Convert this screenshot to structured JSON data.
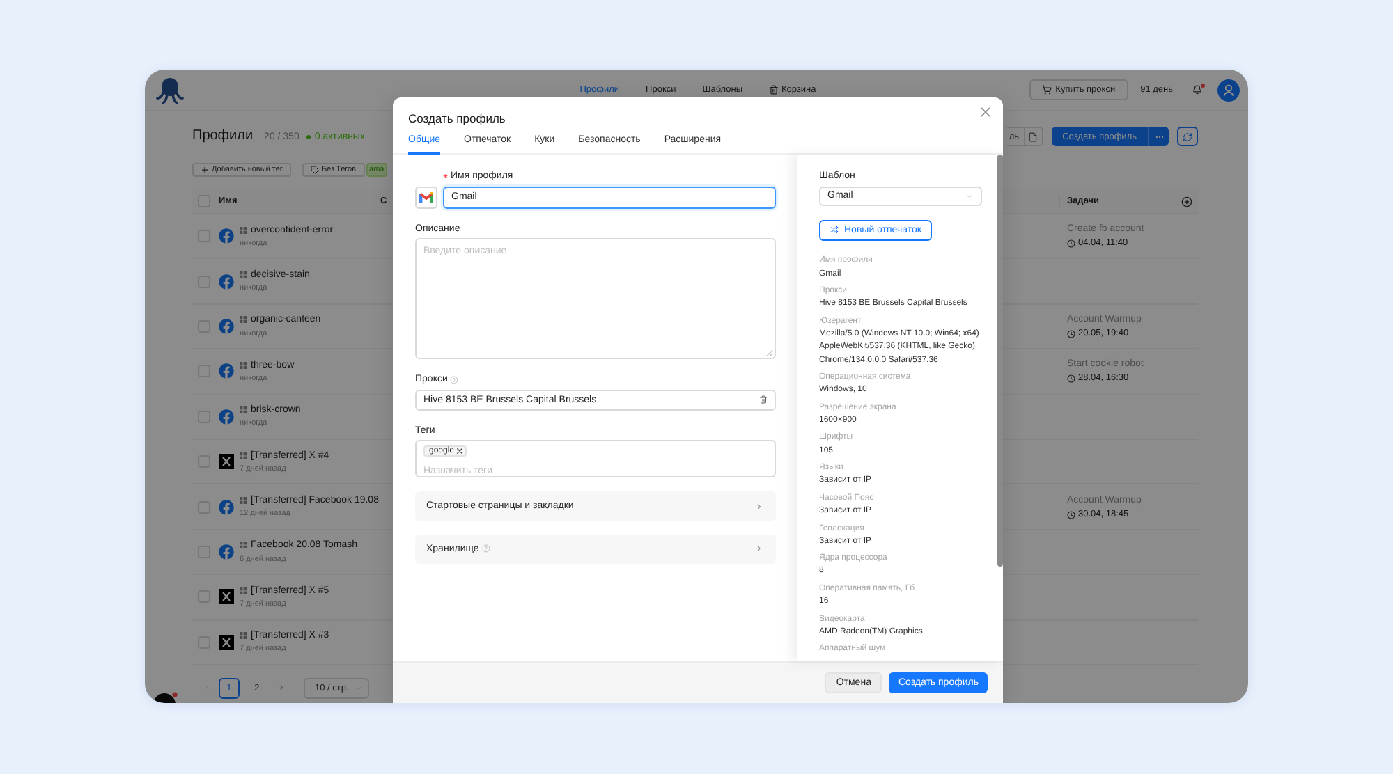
{
  "app_bar": {
    "nav": [
      {
        "label": "Профили",
        "kind": "page",
        "selected": true
      },
      {
        "label": "Прокси",
        "kind": "page",
        "selected": false
      },
      {
        "label": "Шаблоны",
        "kind": "page",
        "selected": false
      },
      {
        "label": "Корзина",
        "kind": "bin",
        "selected": false
      }
    ],
    "buy_button": "Купить прокси",
    "days_left": "91 день",
    "has_unread": true
  },
  "page": {
    "title": "Профили",
    "count": "20 / 350",
    "active": "0 активных",
    "partial_button": "ль",
    "create_button": "Создать профиль"
  },
  "tag_filters": [
    {
      "label": "Добавить новый тег",
      "kind": "add"
    },
    {
      "label": "Без Тегов",
      "kind": "untagged"
    },
    {
      "label": "ama",
      "kind": "tag"
    }
  ],
  "table": {
    "all_checked": false,
    "columns": [
      "Имя",
      "С",
      "Задачи"
    ],
    "rows": [
      {
        "kind": "facebook",
        "name": "overconfident-error",
        "last_used": "никогда",
        "checked": false,
        "task": {
          "title": "Create fb account",
          "time": "04.04, 11:40"
        }
      },
      {
        "kind": "facebook",
        "name": "decisive-stain",
        "last_used": "никогда",
        "checked": false
      },
      {
        "kind": "facebook",
        "name": "organic-canteen",
        "last_used": "никогда",
        "checked": false,
        "task": {
          "title": "Account Warmup",
          "time": "20.05, 19:40"
        }
      },
      {
        "kind": "facebook",
        "name": "three-bow",
        "last_used": "никогда",
        "checked": false,
        "task": {
          "title": "Start cookie robot",
          "time": "28.04, 16:30"
        }
      },
      {
        "kind": "facebook",
        "name": "brisk-crown",
        "last_used": "никогда",
        "checked": false
      },
      {
        "kind": "x",
        "name": "[Transferred] X #4",
        "last_used": "7 дней назад",
        "checked": false
      },
      {
        "kind": "facebook",
        "name": "[Transferred] Facebook 19.08",
        "last_used": "12 дней назад",
        "checked": false,
        "task": {
          "title": "Account Warmup",
          "time": "30.04, 18:45"
        }
      },
      {
        "kind": "facebook",
        "name": "Facebook 20.08 Tomash",
        "last_used": "6 дней назад",
        "checked": false
      },
      {
        "kind": "x",
        "name": "[Transferred] X #5",
        "last_used": "7 дней назад",
        "checked": false
      },
      {
        "kind": "x",
        "name": "[Transferred] X #3",
        "last_used": "7 дней назад",
        "checked": false
      }
    ]
  },
  "pagination": {
    "prev_disabled": true,
    "next_disabled": false,
    "pages": [
      {
        "label": "1",
        "selected": true
      },
      {
        "label": "2",
        "selected": false
      }
    ],
    "page_size": "10 / стр."
  },
  "modal": {
    "title": "Создать профиль",
    "tabs": [
      {
        "label": "Общие",
        "selected": true
      },
      {
        "label": "Отпечаток",
        "selected": false
      },
      {
        "label": "Куки",
        "selected": false
      },
      {
        "label": "Безопасность",
        "selected": false
      },
      {
        "label": "Расширения",
        "selected": false
      }
    ],
    "name_field": {
      "label": "Имя профиля",
      "required": true,
      "value": "Gmail",
      "focused": true
    },
    "description_field": {
      "label": "Описание",
      "placeholder": "Введите описание"
    },
    "proxy_field": {
      "label": "Прокси",
      "has_help": true,
      "value": "Hive 8153 BE Brussels Capital Brussels"
    },
    "tags_field": {
      "label": "Теги",
      "tags": [
        "google"
      ],
      "placeholder": "Назначить теги"
    },
    "sections": [
      {
        "label": "Стартовые страницы и закладки",
        "has_help": false,
        "expanded": false
      },
      {
        "label": "Хранилище",
        "has_help": true,
        "expanded": false
      }
    ],
    "template_field": {
      "label": "Шаблон",
      "value": "Gmail"
    },
    "fingerprint_button": "Новый отпечаток",
    "summary": [
      {
        "label": "Имя профиля",
        "value": "Gmail"
      },
      {
        "label": "Прокси",
        "value": "Hive 8153 BE Brussels Capital Brussels"
      },
      {
        "label": "Юзерагент",
        "value": "Mozilla/5.0 (Windows NT 10.0; Win64; x64) AppleWebKit/537.36 (KHTML, like Gecko) Chrome/134.0.0.0 Safari/537.36"
      },
      {
        "label": "Операционная система",
        "value": "Windows, 10"
      },
      {
        "label": "Разрешение экрана",
        "value": "1600×900"
      },
      {
        "label": "Шрифты",
        "value": "105"
      },
      {
        "label": "Языки",
        "value": "Зависит от IP"
      },
      {
        "label": "Часовой Пояс",
        "value": "Зависит от IP"
      },
      {
        "label": "Геолокация",
        "value": "Зависит от IP"
      },
      {
        "label": "Ядра процессора",
        "value": "8"
      },
      {
        "label": "Оперативная память, Гб",
        "value": "16"
      },
      {
        "label": "Видеокарта",
        "value": "AMD Radeon(TM) Graphics"
      },
      {
        "label": "Аппаратный шум"
      }
    ],
    "cancel_button": "Отмена",
    "submit_button": "Создать профиль"
  }
}
